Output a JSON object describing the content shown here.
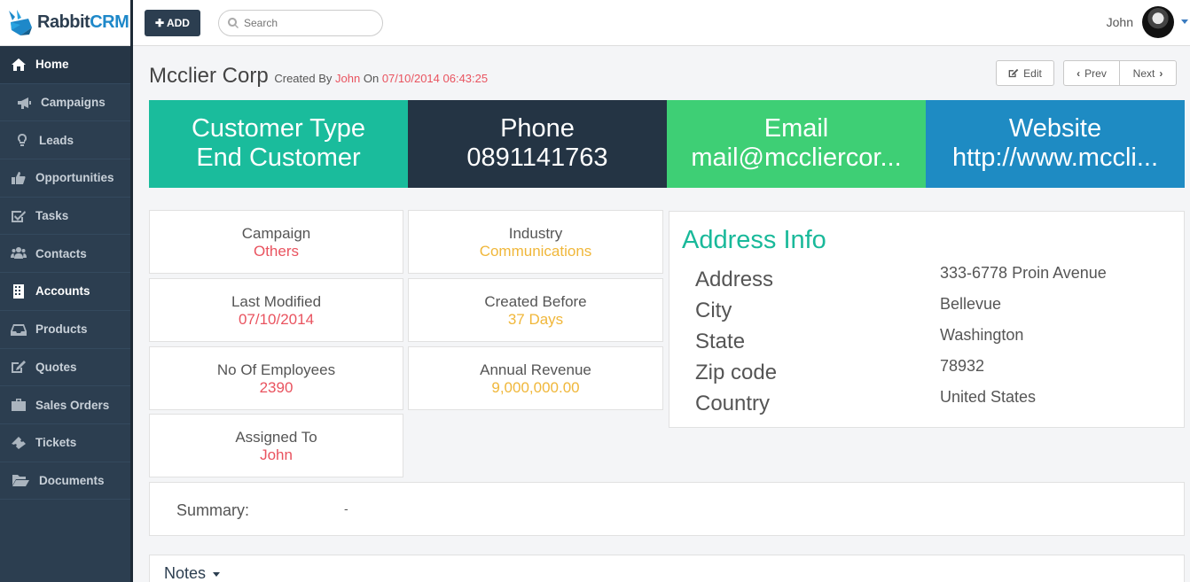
{
  "brand": {
    "name_part1": "Rabbit",
    "name_part2": "CRM"
  },
  "sidebar": {
    "items": [
      {
        "label": "Home",
        "icon": "home-icon",
        "active": true
      },
      {
        "label": "Campaigns",
        "icon": "megaphone-icon"
      },
      {
        "label": "Leads",
        "icon": "lightbulb-icon"
      },
      {
        "label": "Opportunities",
        "icon": "thumbs-up-icon"
      },
      {
        "label": "Tasks",
        "icon": "checkbox-icon"
      },
      {
        "label": "Contacts",
        "icon": "users-icon"
      },
      {
        "label": "Accounts",
        "icon": "building-icon",
        "bold": true
      },
      {
        "label": "Products",
        "icon": "inbox-icon"
      },
      {
        "label": "Quotes",
        "icon": "edit-icon"
      },
      {
        "label": "Sales Orders",
        "icon": "briefcase-icon"
      },
      {
        "label": "Tickets",
        "icon": "ticket-icon"
      },
      {
        "label": "Documents",
        "icon": "folder-open-icon"
      }
    ]
  },
  "topbar": {
    "add_label": "ADD",
    "search_placeholder": "Search",
    "user_name": "John"
  },
  "record": {
    "name": "Mcclier Corp",
    "created_by_label": "Created By",
    "created_by": "John",
    "on_label": "On",
    "created_at": "07/10/2014 06:43:25"
  },
  "actions": {
    "edit": "Edit",
    "prev": "Prev",
    "next": "Next"
  },
  "stats": [
    {
      "label": "Customer Type",
      "value": "End Customer",
      "color": "#1abc9c"
    },
    {
      "label": "Phone",
      "value": "0891141763",
      "color": "#243444"
    },
    {
      "label": "Email",
      "value": "mail@mccliercor...",
      "color": "#3ecf75"
    },
    {
      "label": "Website",
      "value": "http://www.mccli...",
      "color": "#1e8bc3"
    }
  ],
  "details": {
    "campaign": {
      "label": "Campaign",
      "value": "Others"
    },
    "industry": {
      "label": "Industry",
      "value": "Communications"
    },
    "last_modified": {
      "label": "Last Modified",
      "value": "07/10/2014"
    },
    "created_before": {
      "label": "Created Before",
      "value": "37 Days"
    },
    "employees": {
      "label": "No Of Employees",
      "value": "2390"
    },
    "revenue": {
      "label": "Annual Revenue",
      "value": "9,000,000.00"
    },
    "assigned_to": {
      "label": "Assigned To",
      "value": "John"
    }
  },
  "address": {
    "title": "Address Info",
    "rows": [
      {
        "label": "Address",
        "value": "333-6778 Proin Avenue"
      },
      {
        "label": "City",
        "value": "Bellevue"
      },
      {
        "label": "State",
        "value": "Washington"
      },
      {
        "label": "Zip code",
        "value": "78932"
      },
      {
        "label": "Country",
        "value": "United States"
      }
    ]
  },
  "summary": {
    "label": "Summary:",
    "value": "-"
  },
  "notes": {
    "label": "Notes"
  }
}
